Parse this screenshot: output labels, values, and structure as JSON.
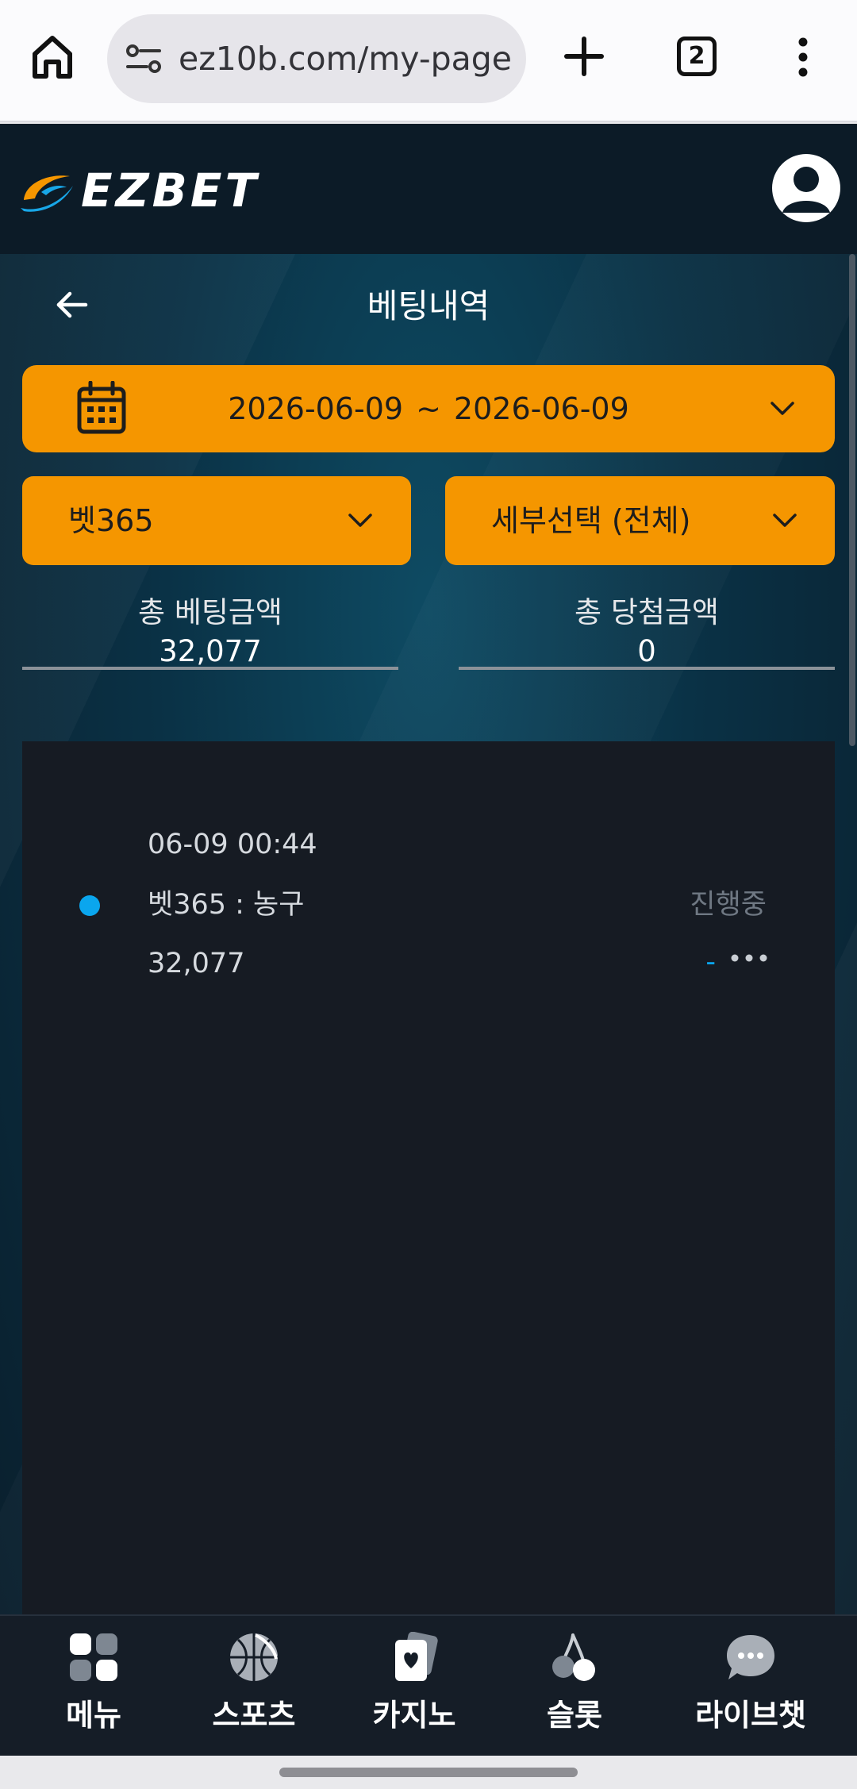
{
  "browser": {
    "url": "ez10b.com/my-page",
    "tab_count": "2"
  },
  "site": {
    "logo_text": "EZBET",
    "page_title": "베팅내역",
    "date_range": {
      "start": "2026-06-09",
      "separator": "~",
      "end": "2026-06-09"
    },
    "provider_select": "벳365",
    "detail_select": "세부선택 (전체)",
    "totals": {
      "bet_label": "총 베팅금액",
      "bet_value": "32,077",
      "win_label": "총 당첨금액",
      "win_value": "0"
    },
    "bets": [
      {
        "datetime": "06-09 00:44",
        "title": "벳365 : 농구",
        "amount": "32,077",
        "status": "진행중",
        "win": "-"
      }
    ]
  },
  "bottom_nav": [
    {
      "label": "메뉴",
      "icon": "menu-grid-icon"
    },
    {
      "label": "스포츠",
      "icon": "basketball-icon"
    },
    {
      "label": "카지노",
      "icon": "cards-icon"
    },
    {
      "label": "슬롯",
      "icon": "cherry-icon"
    },
    {
      "label": "라이브챗",
      "icon": "chat-icon"
    }
  ],
  "colors": {
    "accent": "#f59600",
    "status_dot": "#0aa6ee",
    "panel": "#161b23",
    "header": "#0c1b27"
  }
}
